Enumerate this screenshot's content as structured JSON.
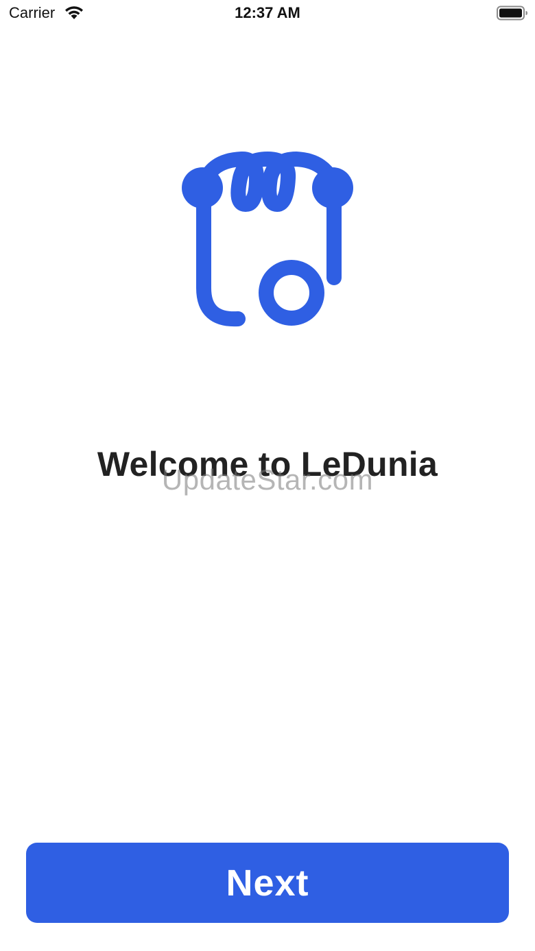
{
  "status_bar": {
    "carrier": "Carrier",
    "time": "12:37 AM",
    "wifi_icon": "wifi-icon",
    "battery_icon": "battery-icon"
  },
  "logo": {
    "icon": "ledunia-logo-icon",
    "color": "#2f5fe3"
  },
  "welcome": {
    "title": "Welcome to LeDunia"
  },
  "watermark": {
    "text": "UpdateStar.com"
  },
  "actions": {
    "next_label": "Next",
    "button_color": "#2f5fe3"
  }
}
